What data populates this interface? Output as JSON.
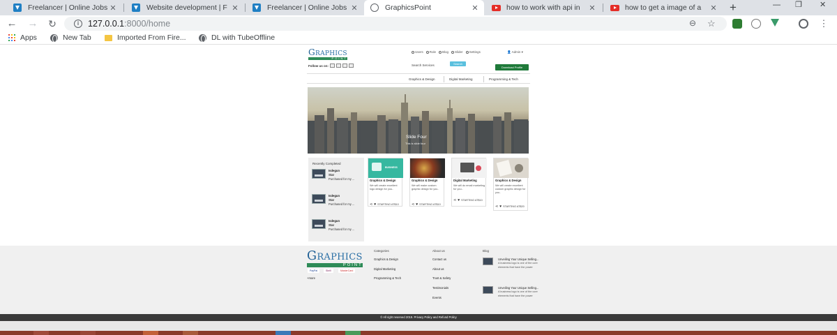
{
  "browser": {
    "tabs": [
      {
        "title": "Freelancer | Online Jobs |",
        "icon": "freelancer-icon"
      },
      {
        "title": "Website development | F",
        "icon": "freelancer-icon"
      },
      {
        "title": "Freelancer | Online Jobs |",
        "icon": "freelancer-icon"
      },
      {
        "title": "GraphicsPoint",
        "icon": "globe-icon",
        "active": true
      },
      {
        "title": "how to work with api in",
        "icon": "youtube-icon"
      },
      {
        "title": "how to get a image of a",
        "icon": "youtube-icon"
      }
    ],
    "new_tab": "+",
    "url_host": "127.0.0.1",
    "url_path": ":8000/home",
    "bookmarks": [
      "Apps",
      "New Tab",
      "Imported From Fire...",
      "DL with TubeOffline"
    ]
  },
  "site": {
    "logo_main": "RAPHICS",
    "logo_g": "G",
    "logo_sub": "POINT",
    "nav": [
      "Users",
      "Role",
      "Blog",
      "Slider",
      "Settings"
    ],
    "admin": "Admin",
    "follow_label": "Follow us on:",
    "search_label": "Search Services",
    "search_button": "Search",
    "download_button": "Download Profile",
    "categories": [
      "Graphics & Design",
      "Digital Marketing",
      "Programming & Tech"
    ],
    "hero_title": "Slide Four",
    "hero_subtitle": "This is slide four",
    "recent_title": "Recently Completed",
    "recent_items": [
      {
        "name": "Isdegun",
        "sub": "Star",
        "desc": "Purchased for my ..."
      },
      {
        "name": "Isdegun",
        "sub": "Star",
        "desc": "Purchased for my ..."
      },
      {
        "name": "Isdegun",
        "sub": "Star",
        "desc": "Purchased for my ..."
      }
    ],
    "services": [
      {
        "title": "Graphics & Design",
        "desc": "We will create excellent logo design for you..",
        "footer": "STARTING AT$10"
      },
      {
        "title": "Graphics & Design",
        "desc": "We will make custom graphic design for you..",
        "footer": "STARTING AT$10"
      },
      {
        "title": "Digital Marketing",
        "desc": "We will do email marketing for you..",
        "footer": "STARTING AT$10"
      },
      {
        "title": "Graphics & Design",
        "desc": "We will create excellent custom graphic design for you..",
        "footer": "STARTING AT$20"
      }
    ],
    "image_badge": "BUSINESS"
  },
  "footer": {
    "col_categories": "Categories",
    "categories": [
      "Graphics & Design",
      "Digital Marketing",
      "Programming & Tech"
    ],
    "col_about": "About us",
    "about": [
      "Contact us",
      "About us",
      "Trust & Safety",
      "Testimonials",
      "Events"
    ],
    "col_blog": "Blog",
    "blog_posts": [
      {
        "title": "Unveiling Your Unique Selling...",
        "desc": "A business logo is one of the core elements that have the power"
      },
      {
        "title": "Unveiling Your Unique Selling...",
        "desc": "A business logo is one of the core elements that have the power"
      }
    ],
    "payments": [
      "PayPal",
      "Skrill",
      "MasterCard"
    ],
    "more": "+more",
    "copyright": "© All right reserved 2019. Privacy Policy and Refund Policy"
  },
  "colors": {
    "accent_green": "#1f7a3a",
    "search_blue": "#5bc0de",
    "logo_blue": "#2a6fa5"
  }
}
